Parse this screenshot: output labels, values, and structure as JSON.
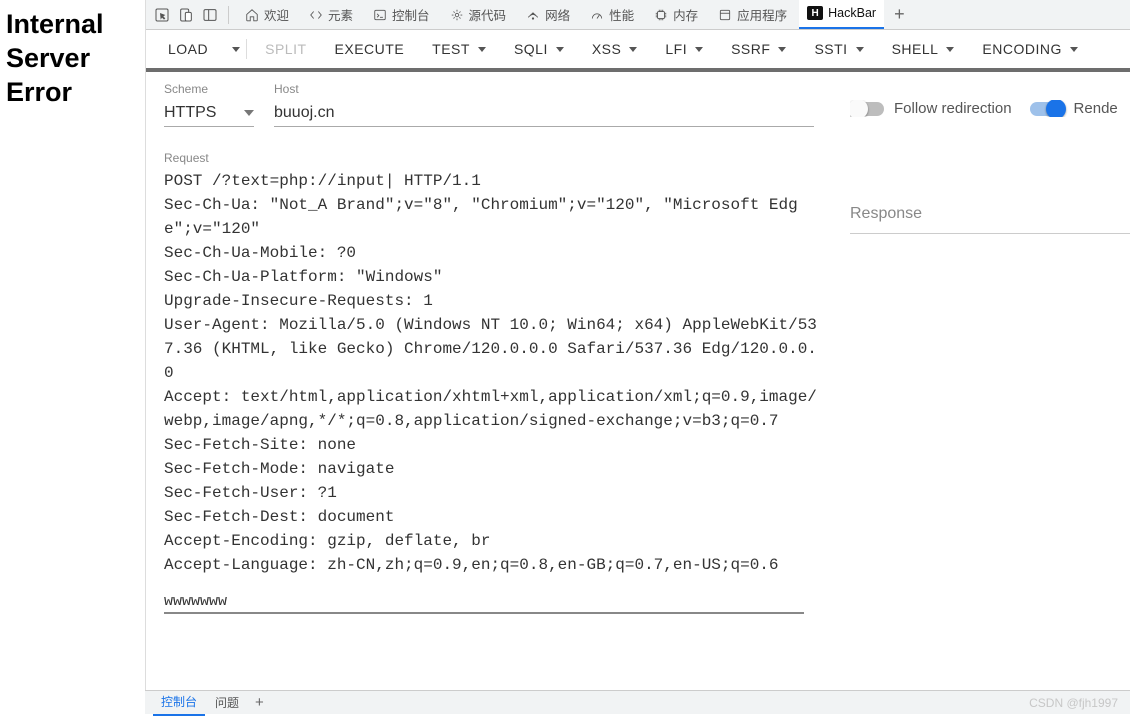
{
  "page": {
    "error_text": "Internal Server Error"
  },
  "devtools": {
    "tabs": [
      {
        "label": "欢迎"
      },
      {
        "label": "元素"
      },
      {
        "label": "控制台"
      },
      {
        "label": "源代码"
      },
      {
        "label": "网络"
      },
      {
        "label": "性能"
      },
      {
        "label": "内存"
      },
      {
        "label": "应用程序"
      },
      {
        "label": "HackBar"
      }
    ],
    "bottom": {
      "console": "控制台",
      "issues": "问题"
    }
  },
  "hackbar": {
    "buttons": {
      "load": "LOAD",
      "split": "SPLIT",
      "execute": "EXECUTE",
      "test": "TEST",
      "sqli": "SQLI",
      "xss": "XSS",
      "lfi": "LFI",
      "ssrf": "SSRF",
      "ssti": "SSTI",
      "shell": "SHELL",
      "encoding": "ENCODING"
    },
    "labels": {
      "scheme": "Scheme",
      "host": "Host",
      "request": "Request",
      "response": "Response"
    },
    "scheme": "HTTPS",
    "host": "buuoj.cn",
    "toggles": {
      "follow_redirection": "Follow redirection",
      "render": "Rende"
    },
    "request_text": "POST /?text=php://input| HTTP/1.1\nSec-Ch-Ua: \"Not_A Brand\";v=\"8\", \"Chromium\";v=\"120\", \"Microsoft Edge\";v=\"120\"\nSec-Ch-Ua-Mobile: ?0\nSec-Ch-Ua-Platform: \"Windows\"\nUpgrade-Insecure-Requests: 1\nUser-Agent: Mozilla/5.0 (Windows NT 10.0; Win64; x64) AppleWebKit/537.36 (KHTML, like Gecko) Chrome/120.0.0.0 Safari/537.36 Edg/120.0.0.0\nAccept: text/html,application/xhtml+xml,application/xml;q=0.9,image/webp,image/apng,*/*;q=0.8,application/signed-exchange;v=b3;q=0.7\nSec-Fetch-Site: none\nSec-Fetch-Mode: navigate\nSec-Fetch-User: ?1\nSec-Fetch-Dest: document\nAccept-Encoding: gzip, deflate, br\nAccept-Language: zh-CN,zh;q=0.9,en;q=0.8,en-GB;q=0.7,en-US;q=0.6",
    "body": "wwwwwww"
  },
  "watermark": "CSDN @fjh1997"
}
